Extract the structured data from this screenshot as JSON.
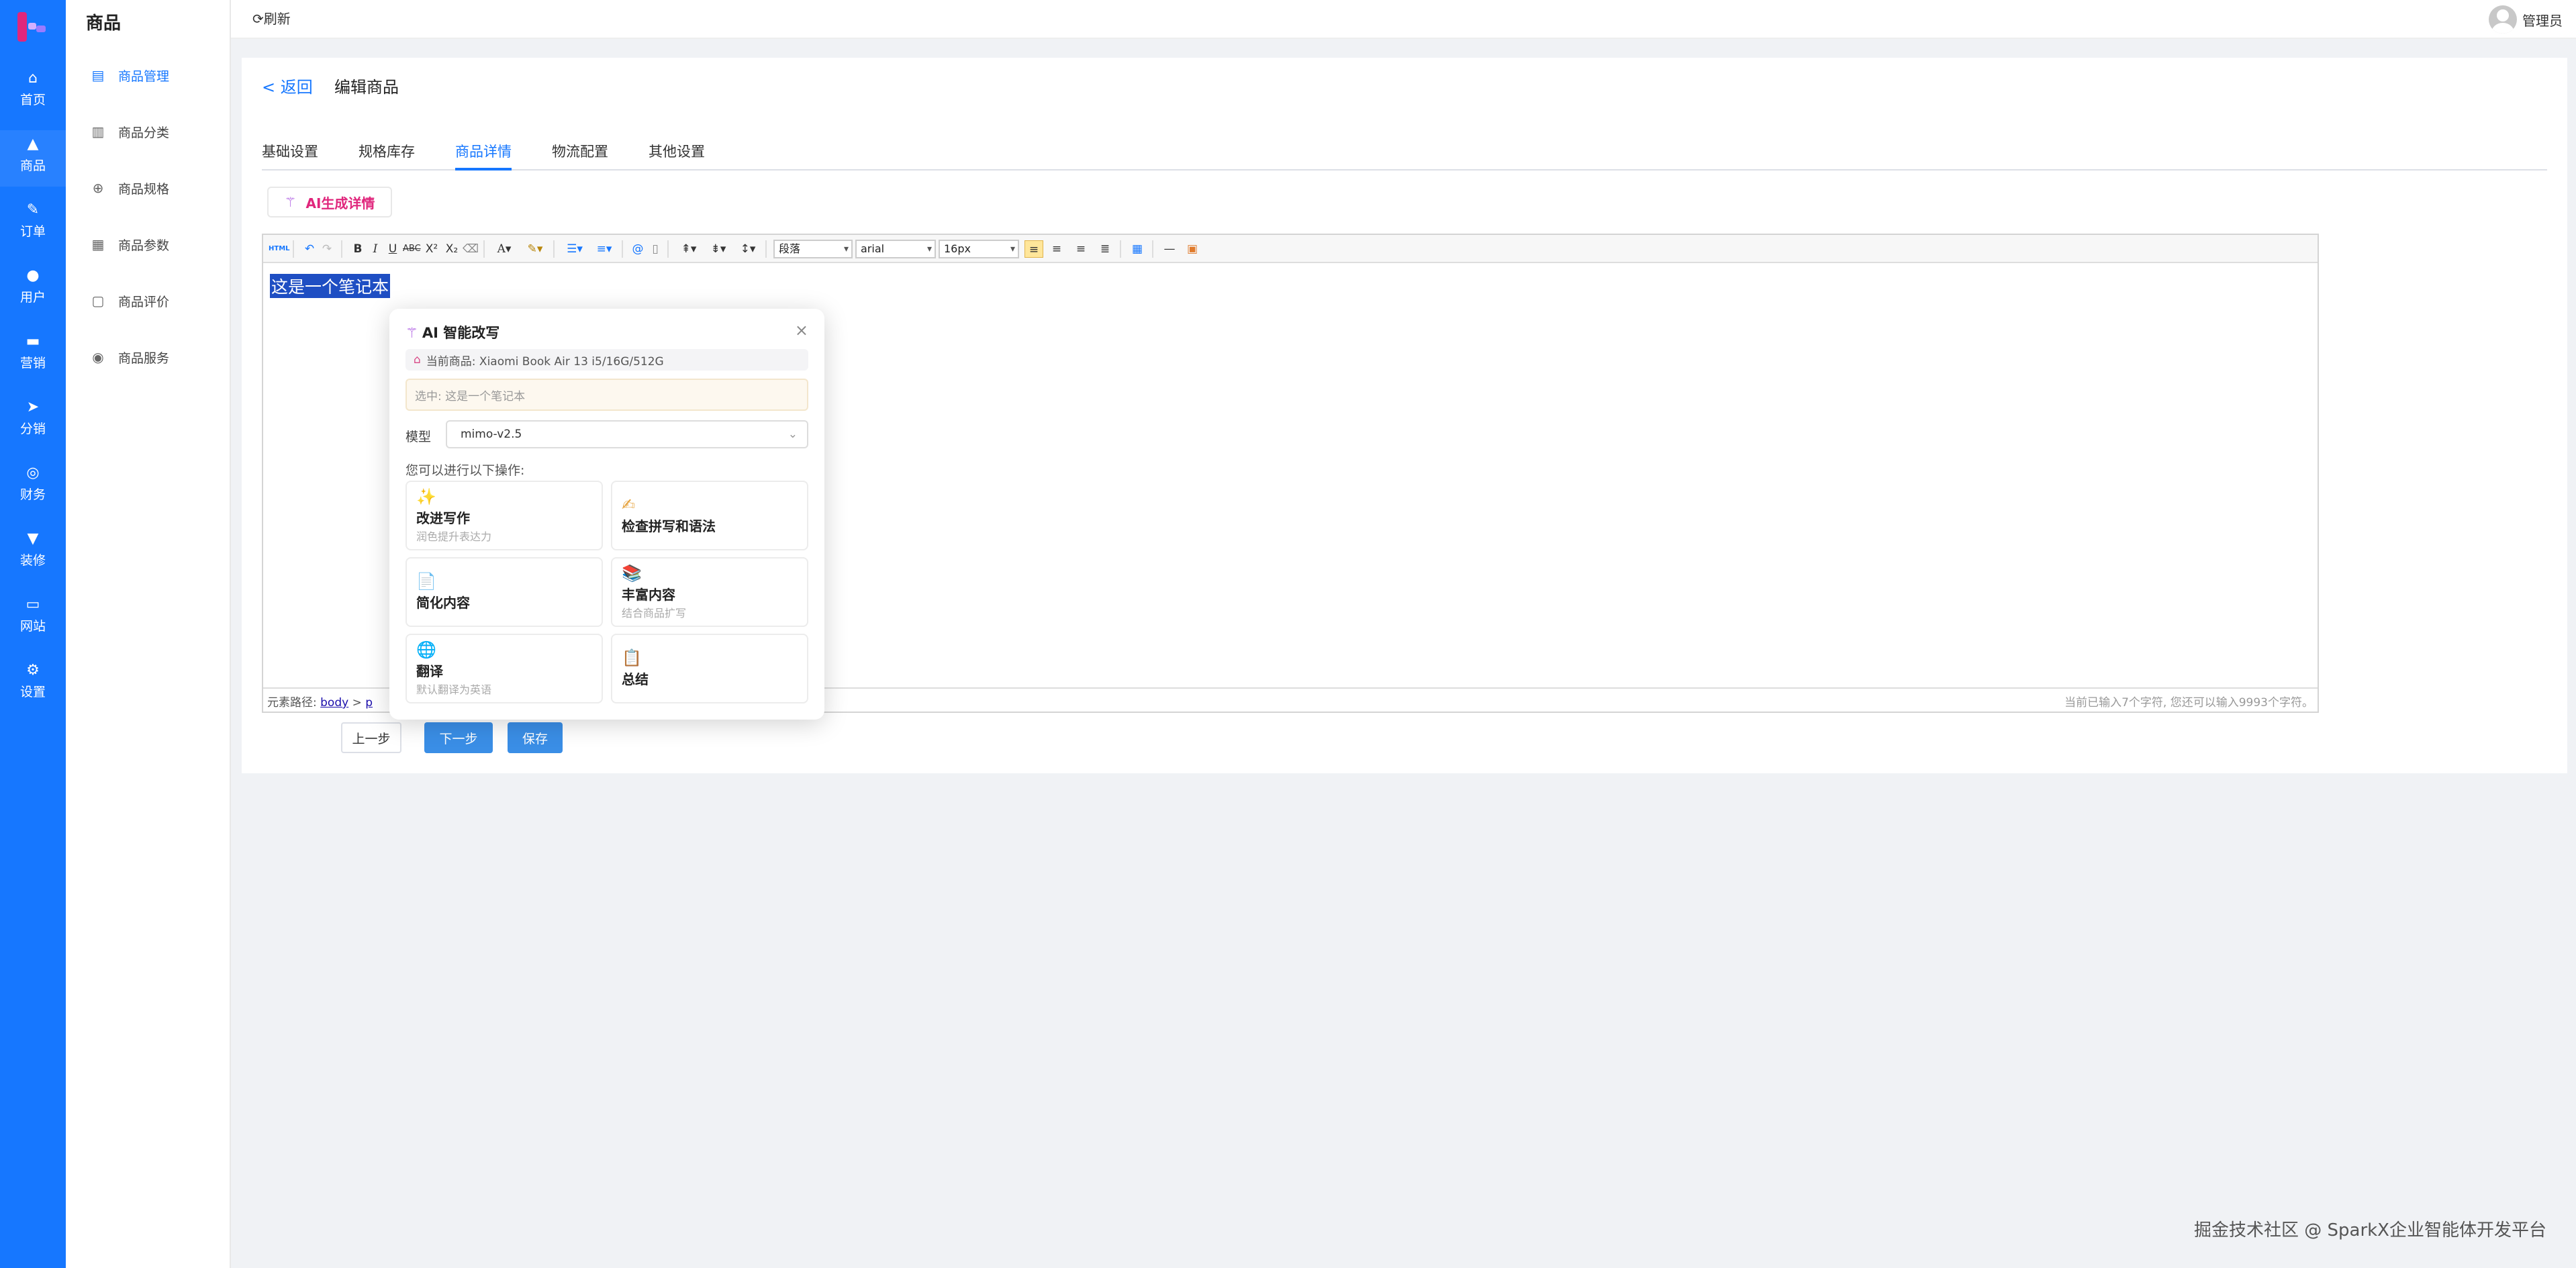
{
  "rail": {
    "items": [
      {
        "label": "首页",
        "icon": "home-icon",
        "glyph": "⌂"
      },
      {
        "label": "商品",
        "icon": "bag-icon",
        "glyph": "▲"
      },
      {
        "label": "订单",
        "icon": "order-icon",
        "glyph": "✎"
      },
      {
        "label": "用户",
        "icon": "user-icon",
        "glyph": "●"
      },
      {
        "label": "营销",
        "icon": "ticket-icon",
        "glyph": "▬"
      },
      {
        "label": "分销",
        "icon": "send-icon",
        "glyph": "➤"
      },
      {
        "label": "财务",
        "icon": "finance-icon",
        "glyph": "◎"
      },
      {
        "label": "装修",
        "icon": "brush-icon",
        "glyph": "▼"
      },
      {
        "label": "网站",
        "icon": "monitor-icon",
        "glyph": "▭"
      },
      {
        "label": "设置",
        "icon": "gear-icon",
        "glyph": "⚙"
      }
    ],
    "active": "商品"
  },
  "sidebar": {
    "title": "商品",
    "items": [
      {
        "label": "商品管理",
        "glyph": "▤"
      },
      {
        "label": "商品分类",
        "glyph": "▥"
      },
      {
        "label": "商品规格",
        "glyph": "⊕"
      },
      {
        "label": "商品参数",
        "glyph": "▦"
      },
      {
        "label": "商品评价",
        "glyph": "▢"
      },
      {
        "label": "商品服务",
        "glyph": "◉"
      }
    ]
  },
  "topbar": {
    "refresh": "⟳刷新",
    "user": "管理员"
  },
  "page": {
    "back": "< 返回",
    "title": "编辑商品"
  },
  "tabs": [
    "基础设置",
    "规格库存",
    "商品详情",
    "物流配置",
    "其他设置"
  ],
  "ai_generate": {
    "label": "AI生成详情",
    "icon": "wand-icon"
  },
  "editor": {
    "content": "这是一个笔记本",
    "paragraph_select": "段落",
    "font_select": "arial",
    "size_select": "16px",
    "status_prefix": "元素路径: ",
    "status_path_body": "body",
    "status_path_sep": " > ",
    "status_path_p": "p",
    "char_count": "当前已输入7个字符, 您还可以输入9993个字符。"
  },
  "buttons": {
    "prev": "上一步",
    "next": "下一步",
    "save": "保存"
  },
  "popup": {
    "title": "AI 智能改写",
    "product": "当前商品: Xiaomi Book Air 13 i5/16G/512G",
    "selected": "选中: 这是一个笔记本",
    "model_label": "模型",
    "model_value": "mimo-v2.5",
    "hint": "您可以进行以下操作:",
    "ops": [
      {
        "name": "改进写作",
        "desc": "润色提升表达力",
        "emoji": "✨"
      },
      {
        "name": "检查拼写和语法",
        "desc": "",
        "emoji": "✍"
      },
      {
        "name": "简化内容",
        "desc": "",
        "emoji": "📄"
      },
      {
        "name": "丰富内容",
        "desc": "结合商品扩写",
        "emoji": "📚"
      },
      {
        "name": "翻译",
        "desc": "默认翻译为英语",
        "emoji": "🌐"
      },
      {
        "name": "总结",
        "desc": "",
        "emoji": "📋"
      }
    ]
  },
  "watermark": "掘金技术社区 @ SparkX企业智能体开发平台",
  "colors": {
    "primary": "#1677ff",
    "ai_pink": "#e0267c",
    "selection": "#1e4ec3"
  }
}
